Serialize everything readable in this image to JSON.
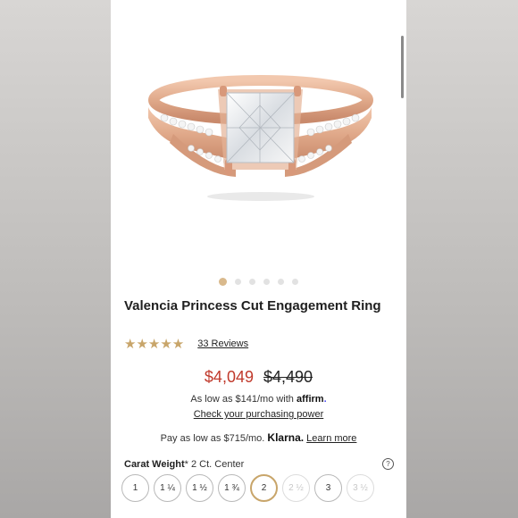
{
  "product": {
    "title": "Valencia Princess Cut Engagement Ring",
    "rating_stars": "★★★★★",
    "reviews": "33 Reviews",
    "price_sale": "$4,049",
    "price_original": "$4,490"
  },
  "carousel": {
    "total": 6,
    "active": 0
  },
  "financing": {
    "affirm_prefix": "As low as $141/mo with",
    "affirm_brand": "affirm",
    "affirm_link": "Check your purchasing power",
    "klarna_prefix": "Pay as low as $715/mo.",
    "klarna_brand": "Klarna.",
    "klarna_link": "Learn more"
  },
  "carat": {
    "label": "Carat Weight",
    "asterisk": "*",
    "value": "2 Ct. Center",
    "help": "?",
    "options": [
      {
        "label": "1",
        "state": "normal"
      },
      {
        "label": "1 ¼",
        "state": "normal"
      },
      {
        "label": "1 ½",
        "state": "normal"
      },
      {
        "label": "1 ¾",
        "state": "normal"
      },
      {
        "label": "2",
        "state": "selected"
      },
      {
        "label": "2 ½",
        "state": "disabled"
      },
      {
        "label": "3",
        "state": "normal"
      },
      {
        "label": "3 ½",
        "state": "disabled"
      }
    ]
  },
  "colors": {
    "accent_gold": "#c8a56a",
    "sale_red": "#c0392b",
    "ring_rose_gold": "#e0a98a"
  }
}
